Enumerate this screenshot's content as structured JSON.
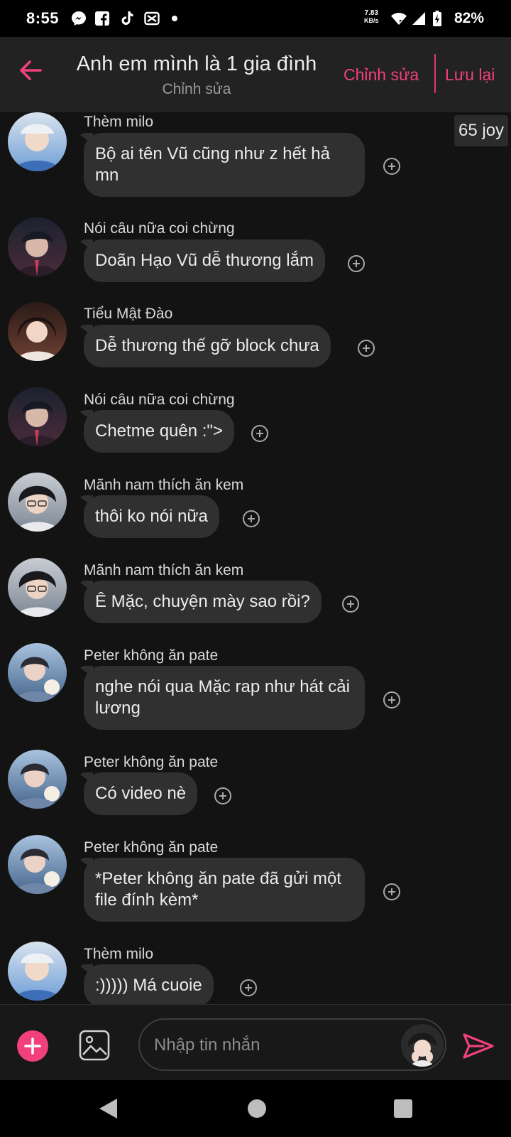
{
  "status_bar": {
    "time": "8:55",
    "net_speed_value": "7.83",
    "net_speed_unit": "KB/s",
    "battery": "82%",
    "notification_icons": [
      "messenger-icon",
      "facebook-icon",
      "tiktok-icon",
      "capcut-icon",
      "dot-icon"
    ]
  },
  "header": {
    "title": "Anh em mình là 1 gia đình",
    "subtitle": "Chỉnh sửa",
    "edit_label": "Chỉnh sửa",
    "save_label": "Lưu lại",
    "accent_color": "#f2407c"
  },
  "joy_badge": "65 joy",
  "messages": [
    {
      "sender": "Thèm milo",
      "text": "Bộ ai tên Vũ cũng như z hết hả mn"
    },
    {
      "sender": "Nói câu nữa coi chừng",
      "text": "Doãn Hạo Vũ dễ thương lắm"
    },
    {
      "sender": "Tiểu Mật Đào",
      "text": "Dễ thương thế gỡ block chưa"
    },
    {
      "sender": "Nói câu nữa coi chừng",
      "text": "Chetme quên :\">"
    },
    {
      "sender": "Mãnh nam thích ăn kem",
      "text": "thôi ko nói nữa"
    },
    {
      "sender": "Mãnh nam thích ăn kem",
      "text": "Ê Mặc, chuyện mày sao rồi?"
    },
    {
      "sender": "Peter không ăn pate",
      "text": "nghe nói qua Mặc rap như hát cải lương"
    },
    {
      "sender": "Peter không ăn pate",
      "text": "Có video nè"
    },
    {
      "sender": "Peter không ăn pate",
      "text": "*Peter không ăn pate đã gửi một file đính kèm*"
    },
    {
      "sender": "Thèm milo",
      "text": ":))))) Má cuoie"
    }
  ],
  "composer": {
    "placeholder": "Nhập tin nhắn",
    "value": ""
  },
  "nav_bar": [
    "back-nav-icon",
    "home-nav-icon",
    "recents-nav-icon"
  ]
}
